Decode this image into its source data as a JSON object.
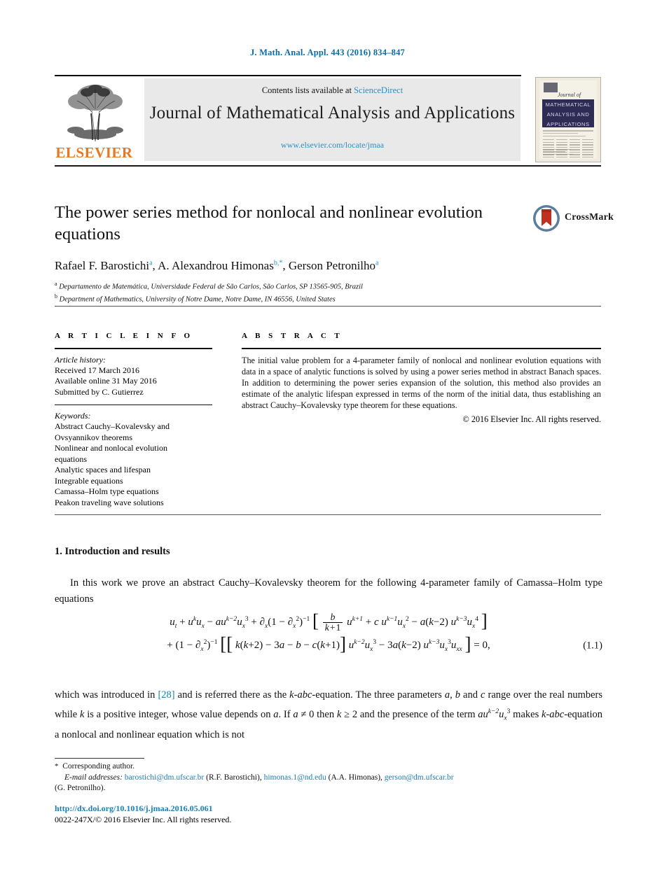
{
  "running_head": "J. Math. Anal. Appl. 443 (2016) 834–847",
  "masthead": {
    "contents_line": "Contents lists available at ",
    "sciencedirect": "ScienceDirect",
    "journal_title": "Journal of Mathematical Analysis and Applications",
    "journal_url": "www.elsevier.com/locate/jmaa",
    "publisher_logo_text": "ELSEVIER",
    "cover": {
      "script_text": "Journal of",
      "band_line1": "MATHEMATICAL",
      "band_line2": "ANALYSIS AND",
      "band_line3": "APPLICATIONS"
    }
  },
  "article": {
    "title": "The power series method for nonlocal and nonlinear evolution equations",
    "crossmark_label": "CrossMark",
    "authors_html": "Rafael F. Barostichi<sup>a</sup>, A. Alexandrou Himonas<sup>b,*</sup>, Gerson Petronilho<sup>a</sup>",
    "affiliations": [
      {
        "marker": "a",
        "text": "Departamento de Matemática, Universidade Federal de São Carlos, São Carlos, SP 13565-905, Brazil"
      },
      {
        "marker": "b",
        "text": "Department of Mathematics, University of Notre Dame, Notre Dame, IN 46556, United States"
      }
    ]
  },
  "article_info": {
    "heading": "A R T I C L E   I N F O",
    "history_title": "Article history:",
    "history": [
      "Received 17 March 2016",
      "Available online 31 May 2016",
      "Submitted by C. Gutierrez"
    ],
    "keywords_title": "Keywords:",
    "keywords": [
      "Abstract Cauchy–Kovalevsky and",
      "Ovsyannikov theorems",
      "Nonlinear and nonlocal evolution",
      "equations",
      "Analytic spaces and lifespan",
      "Integrable equations",
      "Camassa–Holm type equations",
      "Peakon traveling wave solutions"
    ]
  },
  "abstract": {
    "heading": "A B S T R A C T",
    "text": "The initial value problem for a 4-parameter family of nonlocal and nonlinear evolution equations with data in a space of analytic functions is solved by using a power series method in abstract Banach spaces. In addition to determining the power series expansion of the solution, this method also provides an estimate of the analytic lifespan expressed in terms of the norm of the initial data, thus establishing an abstract Cauchy–Kovalevsky type theorem for these equations.",
    "copyright": "© 2016 Elsevier Inc. All rights reserved."
  },
  "body": {
    "section_heading": "1. Introduction and results",
    "paragraph1": "In this work we prove an abstract Cauchy–Kovalevsky theorem for the following 4-parameter family of Camassa–Holm type equations",
    "equation_tag": "(1.1)",
    "paragraph2_pre": "which was introduced in ",
    "paragraph2_ref": "[28]",
    "paragraph2_post": " and is referred there as the k-abc-equation. The three parameters a, b and c range over the real numbers while k is a positive integer, whose value depends on a. If a ≠ 0 then k ≥ 2 and the presence of the term au^{k−2}u_x^3 makes k-abc-equation a nonlocal and nonlinear equation which is not"
  },
  "footnotes": {
    "corresponding": "Corresponding author.",
    "email_label": "E-mail addresses:",
    "emails": [
      {
        "address": "barostichi@dm.ufscar.br",
        "owner": "(R.F. Barostichi)"
      },
      {
        "address": "himonas.1@nd.edu",
        "owner": "(A.A. Himonas)"
      },
      {
        "address": "gerson@dm.ufscar.br",
        "owner": "(G. Petronilho)."
      }
    ]
  },
  "footer": {
    "doi": "http://dx.doi.org/10.1016/j.jmaa.2016.05.061",
    "issn_line": "0022-247X/© 2016 Elsevier Inc. All rights reserved."
  },
  "colors": {
    "link_blue": "#1a7fb5",
    "header_blue": "#0b6ba6",
    "elsevier_orange": "#E87722",
    "banner_gray": "#e9e9e9"
  }
}
